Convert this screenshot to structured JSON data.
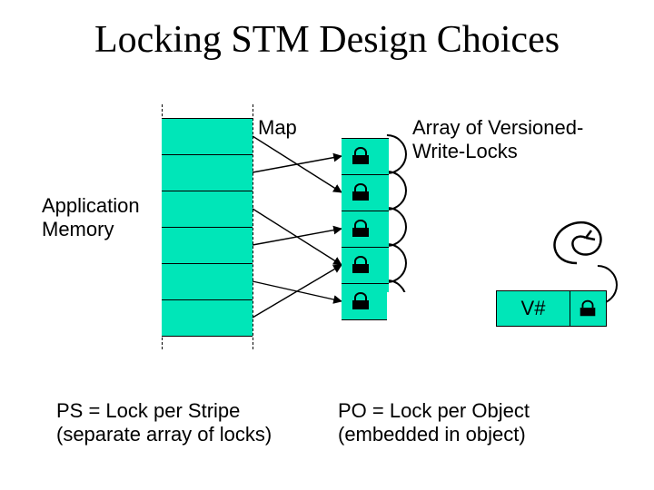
{
  "title": "Locking STM Design Choices",
  "labels": {
    "map": "Map",
    "appmem_line1": "Application",
    "appmem_line2": "Memory",
    "locks_line1": "Array of Versioned-",
    "locks_line2": "Write-Locks",
    "ps_line1": "PS = Lock per Stripe",
    "ps_line2": "(separate array of locks)",
    "po_line1": "PO = Lock per Object",
    "po_line2": "(embedded in object)",
    "vnum": "V#"
  },
  "colors": {
    "fill": "#00e6b8"
  },
  "memory_cells": 6,
  "lock_cells": 5,
  "map_arrows": [
    {
      "from_cell": 0,
      "to_cell": 1
    },
    {
      "from_cell": 1,
      "to_cell": 0
    },
    {
      "from_cell": 2,
      "to_cell": 3
    },
    {
      "from_cell": 3,
      "to_cell": 2
    },
    {
      "from_cell": 4,
      "to_cell": 4
    },
    {
      "from_cell": 5,
      "to_cell": 3
    }
  ],
  "chart_data": {
    "type": "diagram",
    "note": "Schematic, not quantitative. Conveys two STM lock-placement strategies: PS (lock per memory stripe, in a separate lock array, many-to-one hashed map from memory cells to lock slots) and PO (version number V# plus lock embedded in each object)."
  }
}
